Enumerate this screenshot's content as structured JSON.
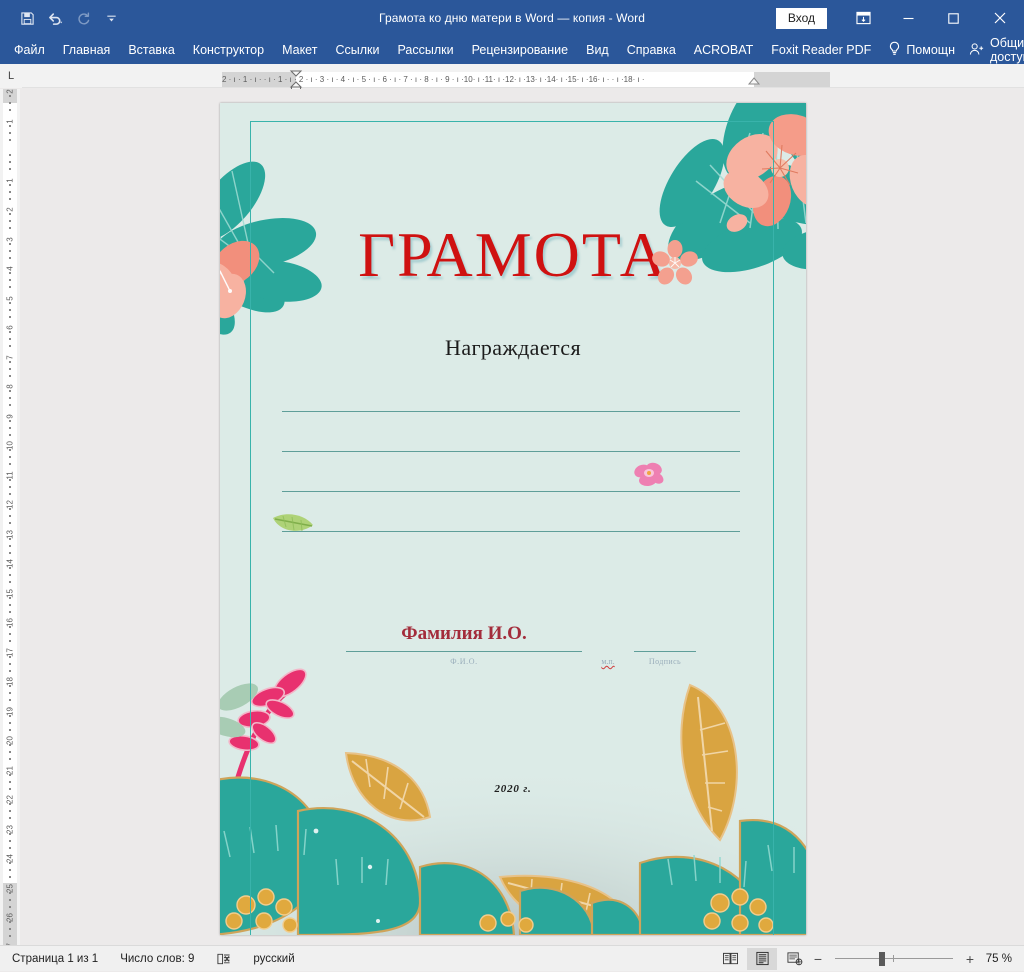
{
  "window": {
    "title": "Грамота ко дню матери в Word — копия  -  Word",
    "signin_label": "Вход",
    "quick_access": [
      {
        "name": "save-icon",
        "label": "Сохранить"
      },
      {
        "name": "undo-icon",
        "label": "Отменить"
      },
      {
        "name": "redo-icon",
        "label": "Вернуть"
      },
      {
        "name": "customize-qat-icon",
        "label": "Настройка панели быстрого доступа"
      }
    ],
    "caption": {
      "ribbon_display_options": "Параметры отображения ленты",
      "minimize": "Свернуть",
      "restore": "Развернуть",
      "close": "Закрыть"
    }
  },
  "ribbon": {
    "tabs": [
      {
        "label": "Файл"
      },
      {
        "label": "Главная"
      },
      {
        "label": "Вставка"
      },
      {
        "label": "Конструктор"
      },
      {
        "label": "Макет"
      },
      {
        "label": "Ссылки"
      },
      {
        "label": "Рассылки"
      },
      {
        "label": "Рецензирование"
      },
      {
        "label": "Вид"
      },
      {
        "label": "Справка"
      },
      {
        "label": "ACROBAT"
      },
      {
        "label": "Foxit Reader PDF"
      }
    ],
    "tell_me": "Помощн",
    "share": "Общий доступ"
  },
  "rulers": {
    "horizontal_ticks": "2 · ı · 1 · ı ·      · ı · 1 · ı · 2 · ı · 3 · ı · 4 · ı · 5 · ı · 6 · ı · 7 · ı · 8 · ı · 9 · ı ·10· ı ·11· ı ·12· ı ·13· ı ·14· ı ·15· ı ·16· ı ·        · ı ·18· ı ·",
    "tab_stop_marker": "L",
    "vertical_ticks": [
      "2",
      "1",
      "",
      "1",
      "2",
      "3",
      "4",
      "5",
      "6",
      "7",
      "8",
      "9",
      "10",
      "11",
      "12",
      "13",
      "14",
      "15",
      "16",
      "17",
      "18",
      "19",
      "20",
      "21",
      "22",
      "23",
      "24",
      "25",
      "26",
      "27"
    ]
  },
  "document": {
    "title": "ГРАМОТА",
    "subtitle": "Награждается",
    "blank_lines": [
      "",
      "",
      "",
      ""
    ],
    "signature_name": "Фамилия И.О.",
    "label_fio": "Ф.И.О.",
    "label_misc": "м.п.",
    "label_signature": "Подпись",
    "year": "2020 г.",
    "colors": {
      "page_background": "#dcebe7",
      "frame_border": "#39b3ab",
      "title_red": "#cf1111",
      "signature_red": "#a32c3b",
      "rule_teal": "#5f9e99",
      "deco_teal": "#27a99a",
      "deco_pink": "#f4a08f",
      "deco_gold": "#d79b3e",
      "deco_magenta": "#e8316f"
    }
  },
  "status_bar": {
    "page_info": "Страница 1 из 1",
    "word_count": "Число слов: 9",
    "proofing_icon": "proofing-errors-icon",
    "language": "русский",
    "views": [
      {
        "name": "read-mode-view-button",
        "label": "Режим чтения",
        "active": false
      },
      {
        "name": "print-layout-view-button",
        "label": "Разметка страницы",
        "active": true
      },
      {
        "name": "web-layout-view-button",
        "label": "Веб-документ",
        "active": false
      }
    ],
    "zoom_out": "−",
    "zoom_in": "+",
    "zoom_value": "75 %",
    "zoom_percent": 75
  }
}
